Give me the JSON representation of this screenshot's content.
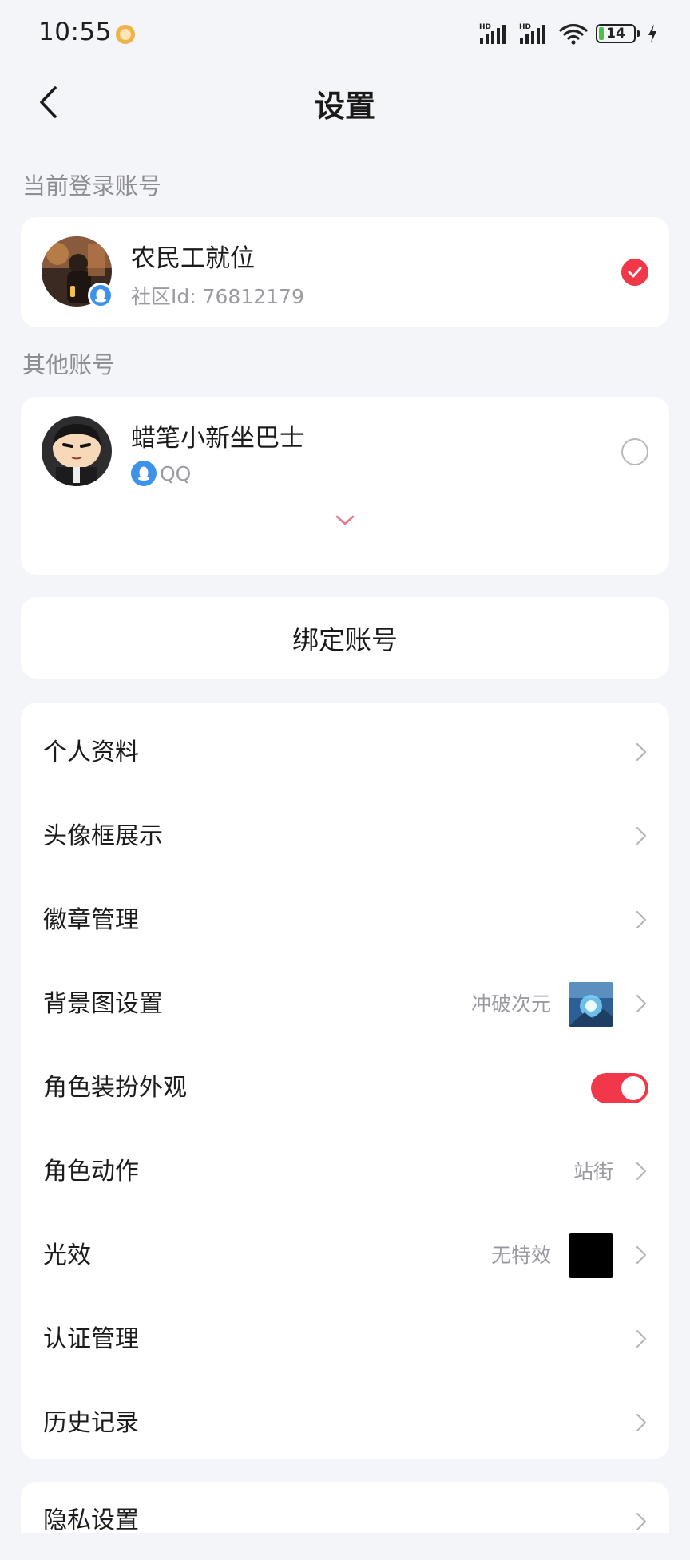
{
  "status_bar": {
    "time": "10:55",
    "battery": "14",
    "icons": [
      "hd-signal-icon",
      "hd-signal-icon",
      "wifi-icon",
      "battery-icon",
      "charging-icon"
    ]
  },
  "header": {
    "title": "设置",
    "back_icon": "chevron-left-icon"
  },
  "current_account": {
    "section_label": "当前登录账号",
    "name": "农民工就位",
    "community_id": "社区Id: 76812179",
    "selected": true
  },
  "other_accounts": {
    "section_label": "其他账号",
    "items": [
      {
        "name": "蜡笔小新坐巴士",
        "platform": "QQ",
        "selected": false
      }
    ]
  },
  "bind_account_label": "绑定账号",
  "menu": [
    {
      "label": "个人资料"
    },
    {
      "label": "头像框展示"
    },
    {
      "label": "徽章管理"
    },
    {
      "label": "背景图设置",
      "value": "冲破次元"
    },
    {
      "label": "角色装扮外观",
      "toggle": true
    },
    {
      "label": "角色动作",
      "value": "站街"
    },
    {
      "label": "光效",
      "value": "无特效"
    },
    {
      "label": "认证管理"
    },
    {
      "label": "历史记录"
    }
  ],
  "menu_secondary": [
    {
      "label": "隐私设置"
    }
  ],
  "colors": {
    "accent": "#f0384a",
    "background": "#f4f5f9",
    "card": "#ffffff",
    "qq_blue": "#3d93ea"
  }
}
